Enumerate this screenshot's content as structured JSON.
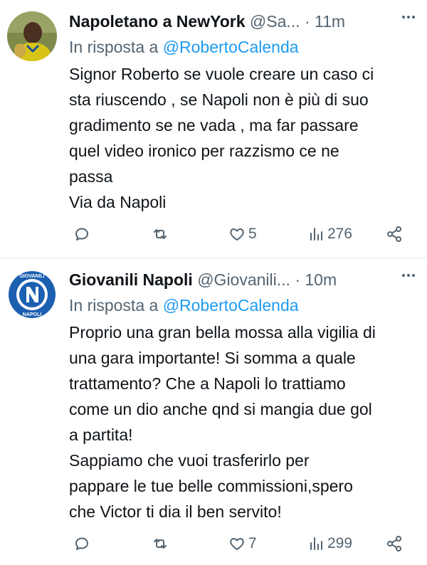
{
  "tweets": [
    {
      "name": "Napoletano a NewYork",
      "handle": "@Sa...",
      "separator": "·",
      "time": "11m",
      "reply_prefix": "In risposta a ",
      "reply_to": "@RobertoCalenda",
      "text": "Signor Roberto se vuole creare un caso ci\nsta riuscendo , se Napoli non è più di suo\ngradimento se ne vada , ma far passare\nquel video ironico per razzismo ce ne\npassa\nVia da Napoli",
      "likes": "5",
      "views": "276",
      "avatar_colors": {
        "bg": "#6b7a3a",
        "shirt": "#d8c417",
        "skin": "#4a3020"
      }
    },
    {
      "name": "Giovanili Napoli",
      "handle": "@Giovanili...",
      "separator": "·",
      "time": "10m",
      "reply_prefix": "In risposta a ",
      "reply_to": "@RobertoCalenda",
      "text": "Proprio una gran bella mossa alla vigilia di\nuna gara importante! Si somma a quale\ntrattamento? Che a Napoli lo trattiamo\ncome un dio anche qnd si mangia due gol\na partita!\nSappiamo che vuoi trasferirlo per\npappare le tue belle commissioni,spero\nche Victor ti dia il ben servito!",
      "likes": "7",
      "views": "299",
      "logo": {
        "top_text": "GIOVANILI",
        "letter": "N",
        "bottom_text": "NAPOLI"
      },
      "avatar_colors": {
        "blue": "#1b5fb0",
        "light": "#ffffff"
      }
    }
  ],
  "colors": {
    "secondary": "#536471",
    "link": "#1d9bf0",
    "text": "#0f1419"
  }
}
